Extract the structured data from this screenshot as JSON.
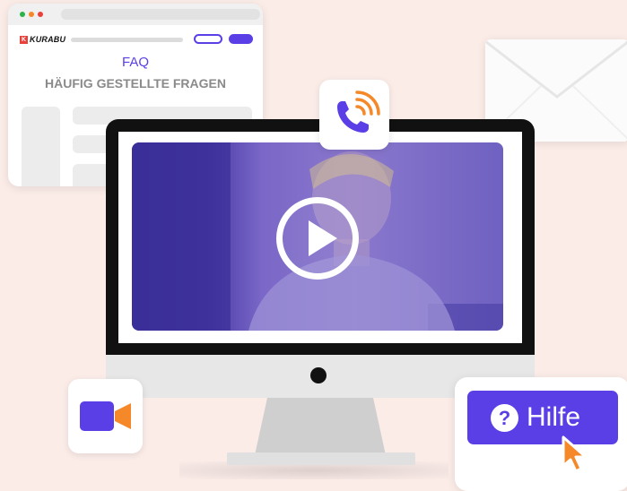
{
  "browser": {
    "logo_mark": "K",
    "logo_text": "KURABU",
    "faq_title": "FAQ",
    "faq_subtitle": "HÄUFIG GESTELLTE FRAGEN"
  },
  "help_button": {
    "label": "Hilfe",
    "icon_glyph": "?"
  },
  "icons": {
    "phone": "phone-call-icon",
    "envelope": "envelope-icon",
    "video": "video-camera-icon",
    "play": "play-icon",
    "cursor": "mouse-cursor-icon"
  },
  "colors": {
    "accent": "#5b3fe6",
    "orange": "#f5892a",
    "background": "#fbece8",
    "video_overlay": "#5a4bbd"
  }
}
